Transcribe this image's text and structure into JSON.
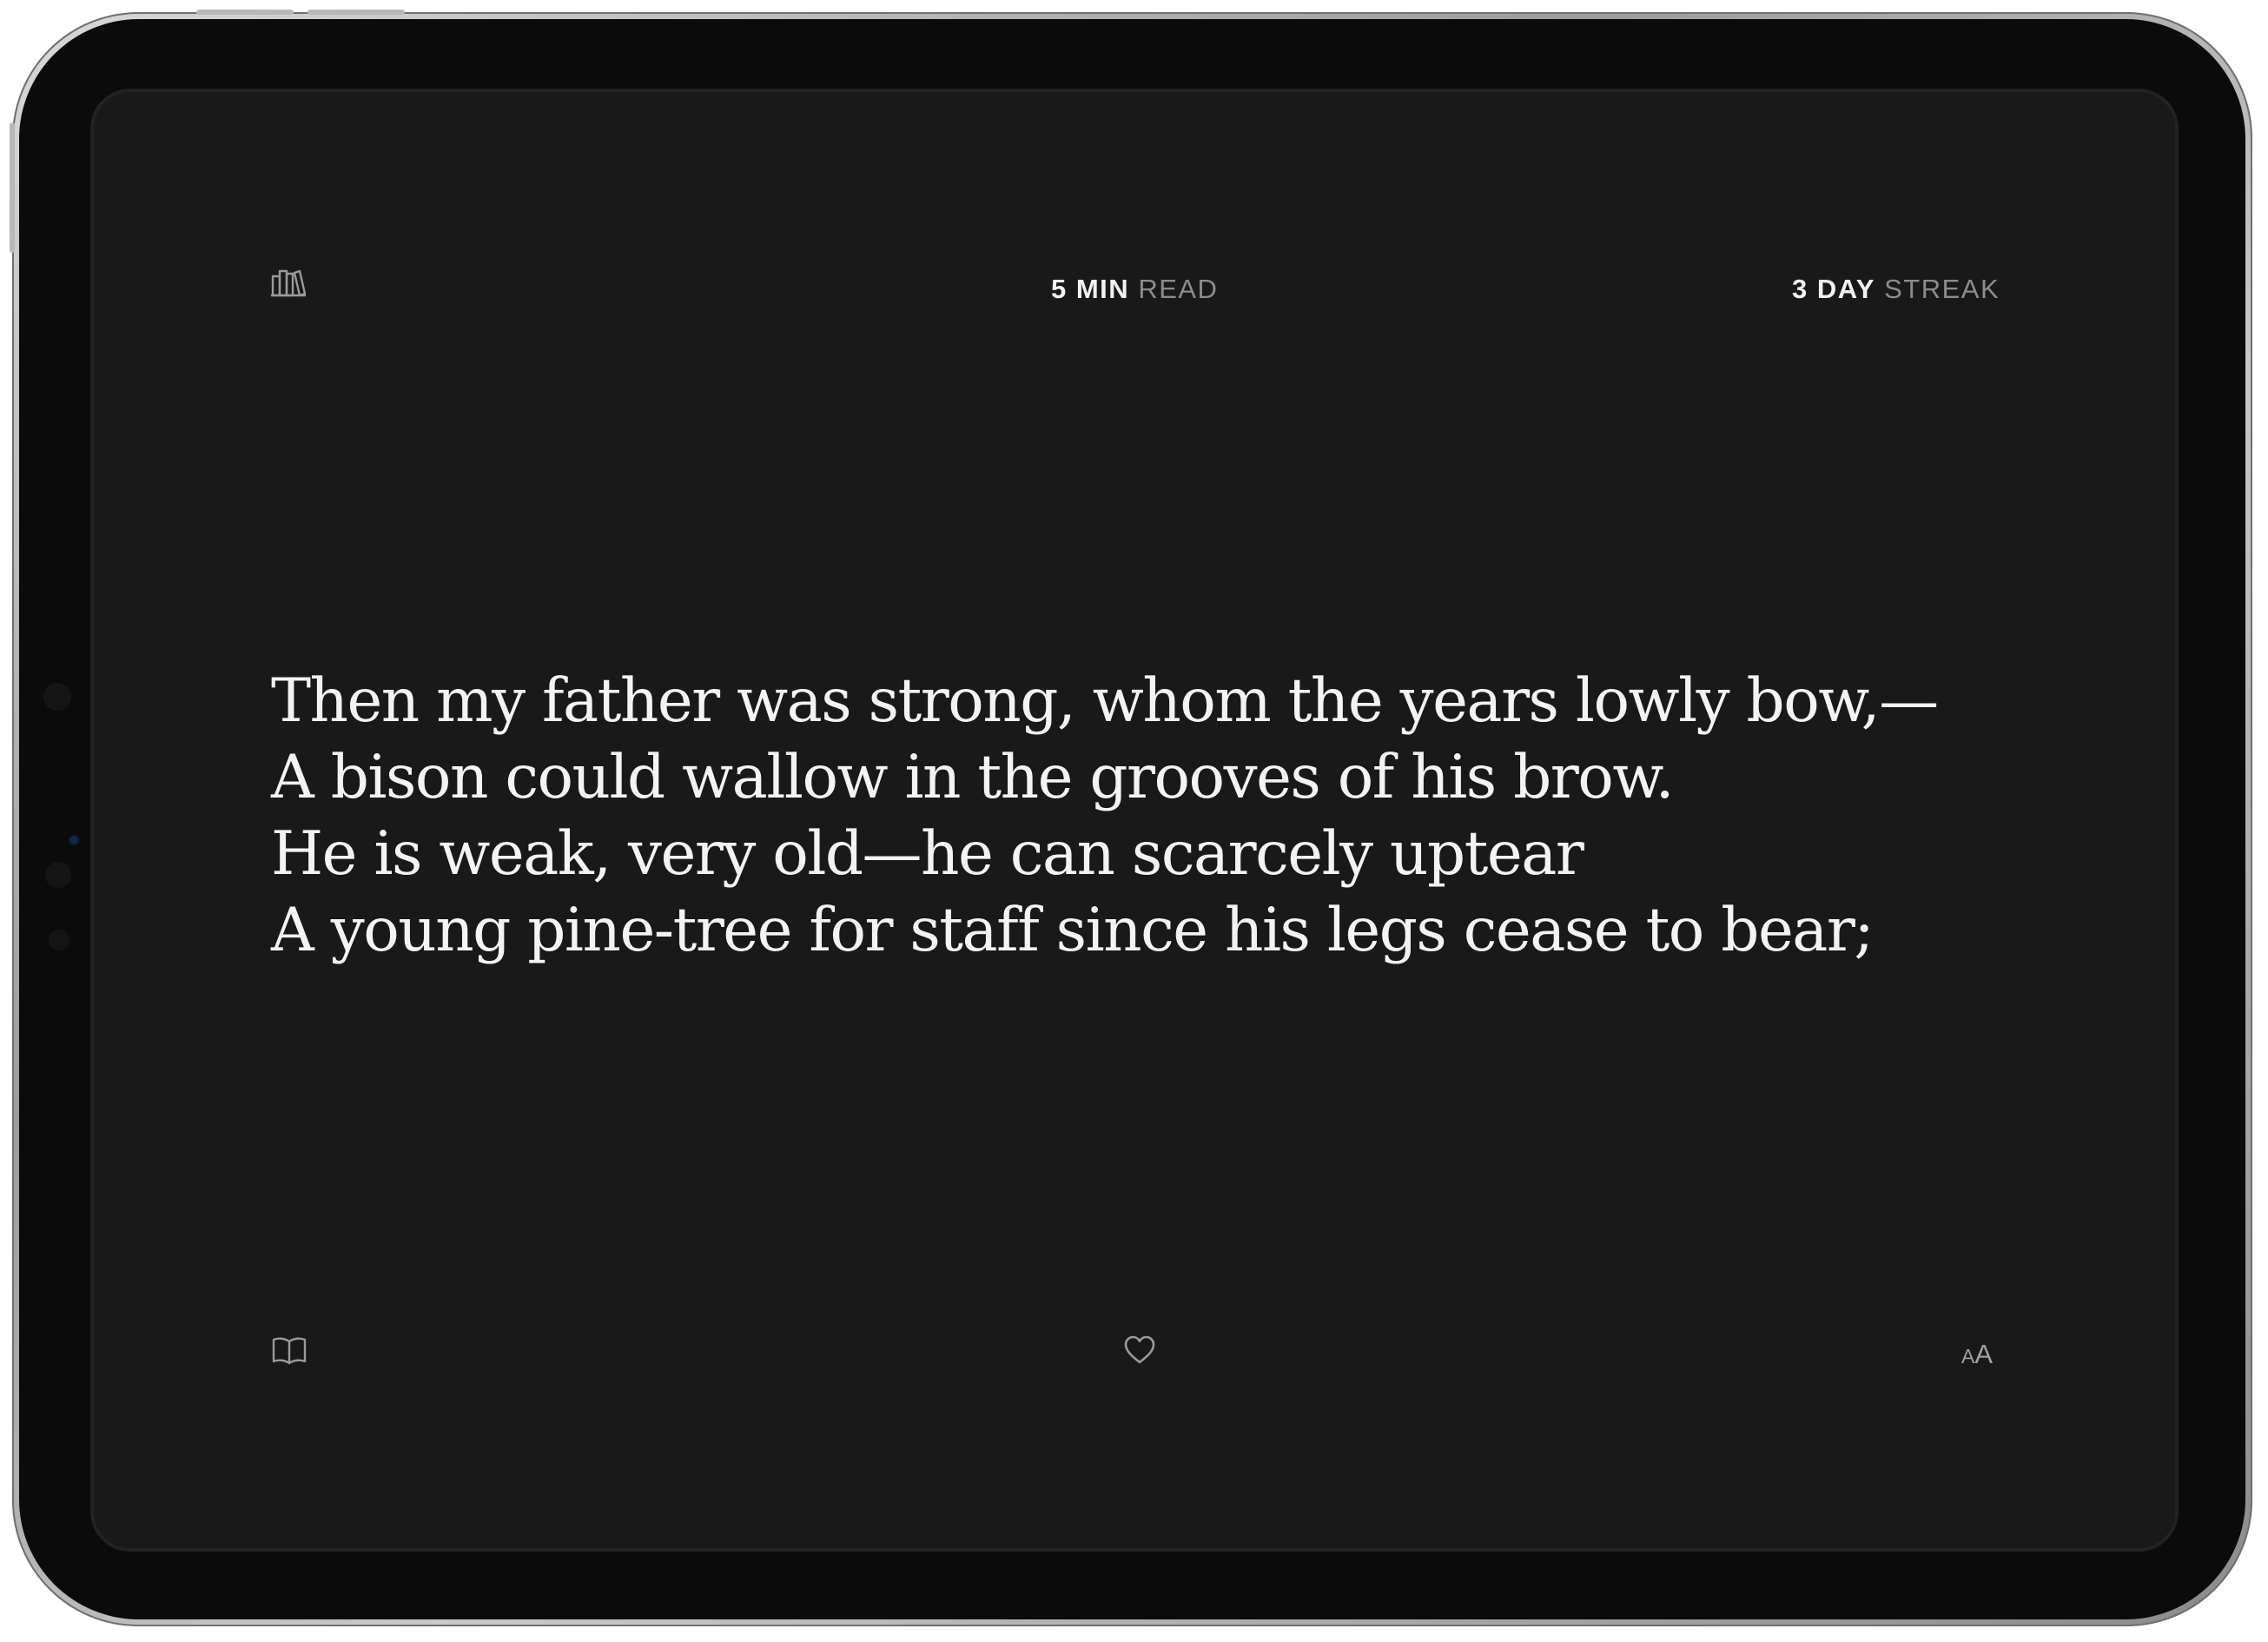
{
  "header": {
    "read_value": "5 MIN",
    "read_label": "READ",
    "streak_value": "3 DAY",
    "streak_label": "STREAK"
  },
  "poem": {
    "lines": [
      "Then my father was strong, whom the years lowly bow,—",
      "A bison could wallow in the grooves of his brow.",
      "He is weak, very old—he can scarcely uptear",
      "A young pine-tree for staff since his legs cease to bear;"
    ]
  },
  "toolbar": {
    "font_size_small": "A",
    "font_size_large": "A"
  },
  "icons": {
    "top_left": "library-icon",
    "bottom_left": "book-icon",
    "bottom_center": "heart-icon",
    "bottom_right": "font-size-icon"
  },
  "colors": {
    "screen_background": "#191919",
    "text_primary": "#f3f3f3",
    "text_secondary": "#8c8c8c"
  }
}
